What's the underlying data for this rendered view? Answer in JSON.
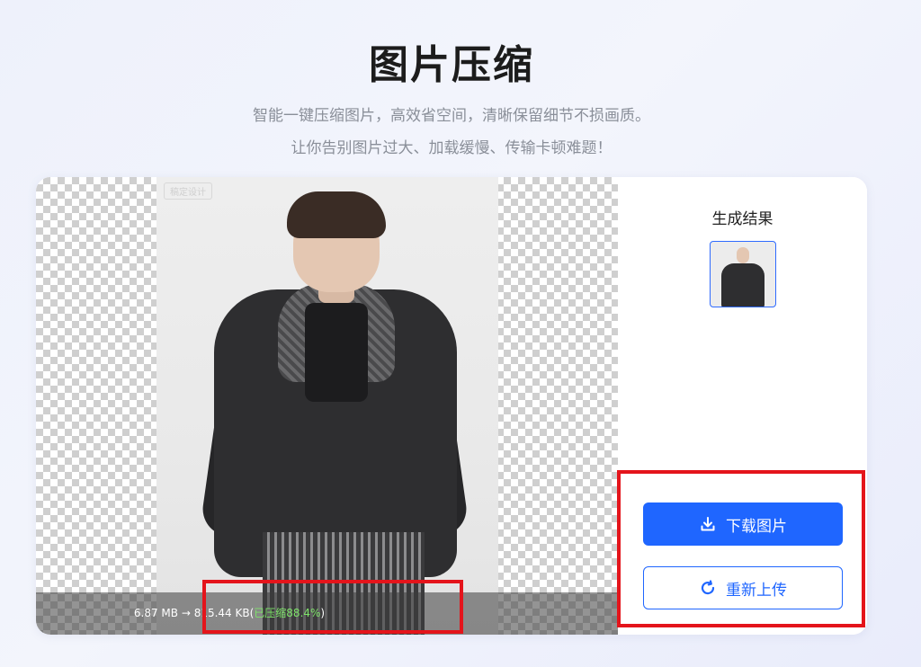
{
  "header": {
    "title": "图片压缩",
    "subtitle_line1": "智能一键压缩图片，高效省空间，清晰保留细节不损画质。",
    "subtitle_line2": "让你告别图片过大、加载缓慢、传输卡顿难题！"
  },
  "preview": {
    "watermark": "稿定设计",
    "original_size": "6.87 MB",
    "arrow": " → ",
    "compressed_size": "815.44 KB",
    "paren_open": "(",
    "compression_label": "已压缩88.4%",
    "paren_close": ")"
  },
  "sidebar": {
    "title": "生成结果",
    "download_label": "下载图片",
    "reupload_label": "重新上传"
  },
  "colors": {
    "accent": "#1f66ff",
    "highlight_green": "#7ee36a",
    "annotation_red": "#e4141b"
  },
  "icons": {
    "download": "download-icon",
    "reupload": "refresh-icon"
  }
}
